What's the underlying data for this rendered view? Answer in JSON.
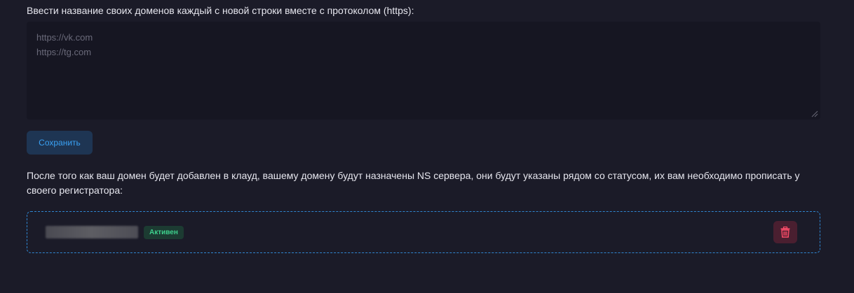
{
  "domains_form": {
    "label": "Ввести название своих доменов каждый с новой строки вместе с протоколом (https):",
    "textarea_placeholder": "https://vk.com\nhttps://tg.com",
    "save_label": "Сохранить"
  },
  "info_text": "После того как ваш домен будет добавлен в клауд, вашему домену будут назначены NS сервера, они будут указаны рядом со статусом, их вам необходимо прописать у своего регистратора:",
  "domain_entry": {
    "status": "Активен",
    "delete_icon": "trash-icon"
  },
  "colors": {
    "background": "#1b1b28",
    "accent": "#3aa2f5",
    "status_active": "#3ed08c",
    "danger": "#ff4d6a"
  }
}
